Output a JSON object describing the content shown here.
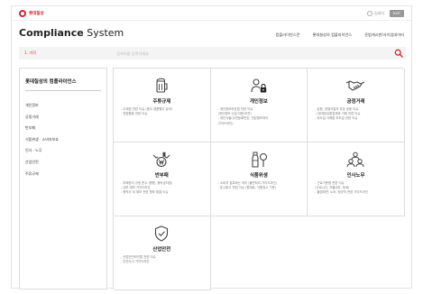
{
  "brand": {
    "logo_text": "롯데칠성",
    "accent": "#d8262f"
  },
  "topbar": {
    "user_label": "김세식",
    "exit_label": "EXIT"
  },
  "header": {
    "title_bold": "Compliance",
    "title_rest": " System",
    "nav": [
      "컴플라이언스란",
      "롯데칠성의 컴플라이언스",
      "준법게시판/사이업데이터"
    ]
  },
  "search": {
    "category": "1. 가각",
    "placeholder": "검색어를 입력하세요"
  },
  "sidebar": {
    "title": "롯데칠성의 컴플라이언스",
    "items": [
      "개인정보",
      "공정거래",
      "반부패",
      "식품위생 · 소비자보호",
      "인사 · 노무",
      "산업안전",
      "주류규제"
    ]
  },
  "cards": [
    {
      "icon": "beer-mug-icon",
      "title": "주류규제",
      "desc": [
        "- 주세법 관련 이슈 (종주·경품행사 유의)",
        "- 영업활동 관련 이슈"
      ]
    },
    {
      "icon": "person-lock-icon",
      "title": "개인정보",
      "desc": [
        "- 개인정보보호법 관련 이슈",
        "  (개인정보 수집·이용·보관)",
        "- 개인식별(주민등록번호, 민감정보처리",
        "  가이드라인)"
      ]
    },
    {
      "icon": "handshake-icon",
      "title": "공정거래",
      "desc": [
        "- 담합, 경쟁사업자 부당 공동 이슈",
        "- 대리점/유통업체와 거래 관련 이슈",
        "- 하도급 거래법 하도급 관련 이슈"
      ]
    },
    {
      "icon": "hands-money-icon",
      "title": "반부패",
      "desc": [
        "- 부패방지 규정 준수 (향응, 청탁금지법)",
        "- 내부 제보 가이드라인",
        "- 협력사 외 제보 관련 협조·체결 이슈"
      ]
    },
    {
      "icon": "bottle-icon",
      "title": "식품위생",
      "desc": [
        "- 소비자 접촉하는 처리 (불만처리 가이드라인)",
        "- 표시광고 관련 이슈 (원재료, 식품표시 기준)"
      ]
    },
    {
      "icon": "people-icon",
      "title": "인사노무",
      "desc": [
        "- 근로기준법 관련 이슈",
        "  (근로시간, 차별대우, 정계)",
        "- 불법파견, 노조, 정규직 관련 가이드라인"
      ]
    },
    {
      "icon": "shield-check-icon",
      "title": "산업안전",
      "desc": [
        "- 산업안전보건법 관련 이슈",
        "- 안전사고 가이드라인"
      ]
    }
  ]
}
